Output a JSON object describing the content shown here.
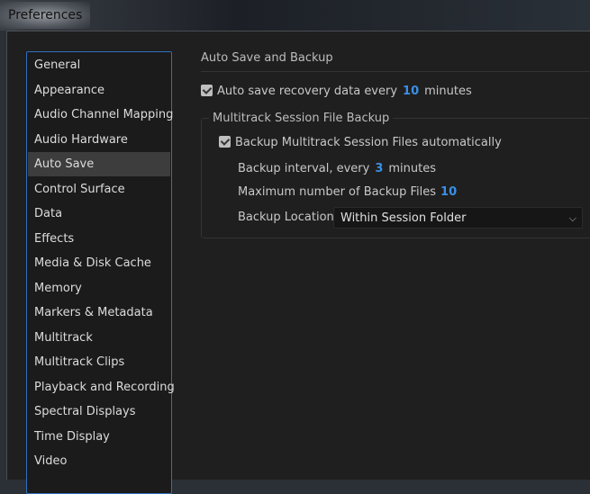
{
  "window": {
    "title": "Preferences"
  },
  "sidebar": {
    "items": [
      {
        "label": "General"
      },
      {
        "label": "Appearance"
      },
      {
        "label": "Audio Channel Mapping"
      },
      {
        "label": "Audio Hardware"
      },
      {
        "label": "Auto Save"
      },
      {
        "label": "Control Surface"
      },
      {
        "label": "Data"
      },
      {
        "label": "Effects"
      },
      {
        "label": "Media & Disk Cache"
      },
      {
        "label": "Memory"
      },
      {
        "label": "Markers & Metadata"
      },
      {
        "label": "Multitrack"
      },
      {
        "label": "Multitrack Clips"
      },
      {
        "label": "Playback and Recording"
      },
      {
        "label": "Spectral Displays"
      },
      {
        "label": "Time Display"
      },
      {
        "label": "Video"
      }
    ],
    "selected": "Auto Save"
  },
  "main": {
    "heading": "Auto Save and Backup",
    "autosave": {
      "label": "Auto save recovery data every",
      "value": "10",
      "unit": "minutes",
      "checked": true
    },
    "group": {
      "title": "Multitrack Session File Backup",
      "backup_auto": {
        "label": "Backup Multitrack Session Files automatically",
        "checked": true
      },
      "interval": {
        "label": "Backup interval, every",
        "value": "3",
        "unit": "minutes"
      },
      "max_files": {
        "label": "Maximum number of Backup Files",
        "value": "10"
      },
      "location": {
        "label": "Backup Location",
        "value": "Within Session Folder"
      }
    }
  },
  "colors": {
    "accent": "#3b8fe6",
    "list_border": "#2f6fc0",
    "selected_bg": "#3d3d3d"
  }
}
